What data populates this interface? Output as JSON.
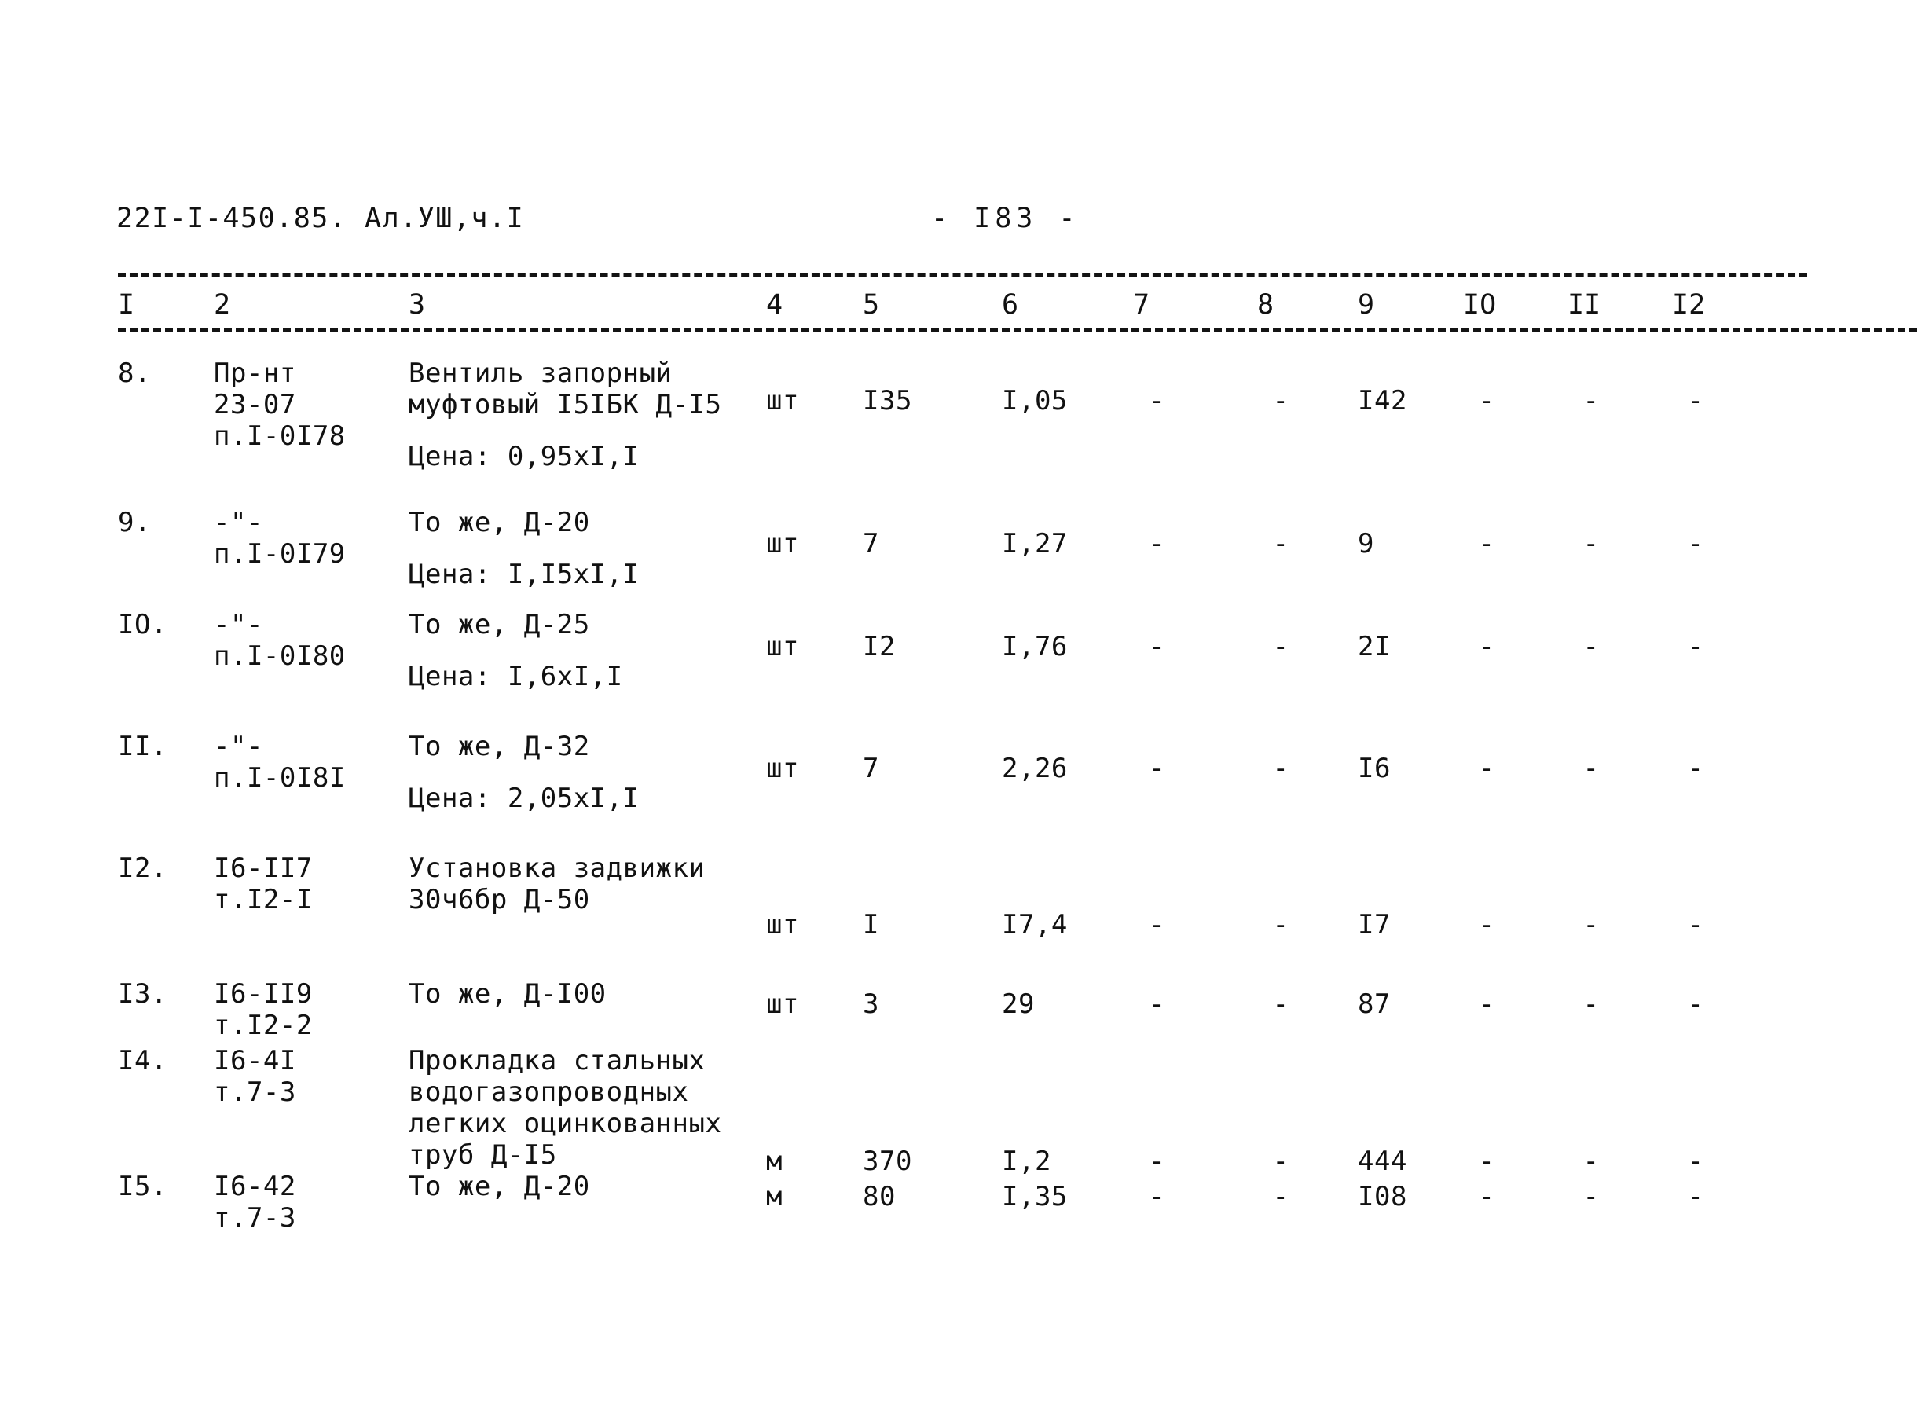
{
  "document": {
    "header_code": "22I-I-450.85. Ал.УШ,ч.I",
    "page_label": "-  I83  -"
  },
  "table": {
    "column_headers": [
      "I",
      "2",
      "3",
      "4",
      "5",
      "6",
      "7",
      "8",
      "9",
      "IO",
      "II",
      "I2"
    ],
    "rows": [
      {
        "num": "8.",
        "code_lines": [
          "Пр-нт",
          "23-07",
          "п.I-0I78"
        ],
        "desc_lines": [
          "Вентиль запорный",
          "муфтовый I5IБК Д-I5"
        ],
        "price_note": "Цена: 0,95хI,I",
        "unit": "шт",
        "qty": "I35",
        "c6": "I,05",
        "c7": "-",
        "c8": "-",
        "c9": "I42",
        "c10": "-",
        "c11": "-",
        "c12": "-"
      },
      {
        "num": "9.",
        "code_lines": [
          "-\"-",
          "п.I-0I79"
        ],
        "desc_lines": [
          "То же, Д-20"
        ],
        "price_note": "Цена: I,I5хI,I",
        "unit": "шт",
        "qty": "7",
        "c6": "I,27",
        "c7": "-",
        "c8": "-",
        "c9": "9",
        "c10": "-",
        "c11": "-",
        "c12": "-"
      },
      {
        "num": "IO.",
        "code_lines": [
          "-\"-",
          "п.I-0I80"
        ],
        "desc_lines": [
          "То же, Д-25"
        ],
        "price_note": "Цена: I,6хI,I",
        "unit": "шт",
        "qty": "I2",
        "c6": "I,76",
        "c7": "-",
        "c8": "-",
        "c9": "2I",
        "c10": "-",
        "c11": "-",
        "c12": "-"
      },
      {
        "num": "II.",
        "code_lines": [
          "-\"-",
          "п.I-0I8I"
        ],
        "desc_lines": [
          "То же, Д-32"
        ],
        "price_note": "Цена: 2,05хI,I",
        "unit": "шт",
        "qty": "7",
        "c6": "2,26",
        "c7": "-",
        "c8": "-",
        "c9": "I6",
        "c10": "-",
        "c11": "-",
        "c12": "-"
      },
      {
        "num": "I2.",
        "code_lines": [
          "I6-II7",
          "т.I2-I"
        ],
        "desc_lines": [
          "Установка задвижки",
          "30ч6бр Д-50"
        ],
        "price_note": "",
        "unit": "шт",
        "qty": "I",
        "c6": "I7,4",
        "c7": "-",
        "c8": "-",
        "c9": "I7",
        "c10": "-",
        "c11": "-",
        "c12": "-"
      },
      {
        "num": "I3.",
        "code_lines": [
          "I6-II9",
          "т.I2-2"
        ],
        "desc_lines": [
          "То же, Д-I00"
        ],
        "price_note": "",
        "unit": "шт",
        "qty": "3",
        "c6": "29",
        "c7": "-",
        "c8": "-",
        "c9": "87",
        "c10": "-",
        "c11": "-",
        "c12": "-"
      },
      {
        "num": "I4.",
        "code_lines": [
          "I6-4I",
          "т.7-3"
        ],
        "desc_lines": [
          "Прокладка стальных",
          "водогазопроводных",
          "легких оцинкованных",
          "труб Д-I5"
        ],
        "price_note": "",
        "unit": "м",
        "qty": "370",
        "c6": "I,2",
        "c7": "-",
        "c8": "-",
        "c9": "444",
        "c10": "-",
        "c11": "-",
        "c12": "-"
      },
      {
        "num": "I5.",
        "code_lines": [
          "I6-42",
          "т.7-3"
        ],
        "desc_lines": [
          "То же, Д-20"
        ],
        "price_note": "",
        "unit": "м",
        "qty": "80",
        "c6": "I,35",
        "c7": "-",
        "c8": "-",
        "c9": "I08",
        "c10": "-",
        "c11": "-",
        "c12": "-"
      }
    ]
  }
}
